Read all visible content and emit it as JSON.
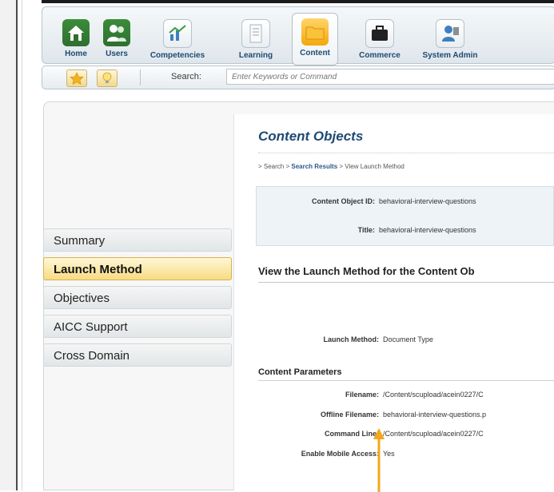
{
  "nav": {
    "items": [
      {
        "label": "Home",
        "icon": "home-icon"
      },
      {
        "label": "Users",
        "icon": "users-icon"
      },
      {
        "label": "Competencies",
        "icon": "chart-icon"
      },
      {
        "label": "Learning",
        "icon": "document-icon"
      },
      {
        "label": "Content",
        "icon": "folder-icon",
        "active": true
      },
      {
        "label": "Commerce",
        "icon": "briefcase-icon"
      },
      {
        "label": "System Admin",
        "icon": "admin-icon"
      }
    ]
  },
  "search": {
    "label": "Search:",
    "placeholder": "Enter Keywords or Command"
  },
  "sidebar": {
    "items": [
      {
        "label": "Summary"
      },
      {
        "label": "Launch Method",
        "active": true
      },
      {
        "label": "Objectives"
      },
      {
        "label": "AICC Support"
      },
      {
        "label": "Cross Domain"
      }
    ]
  },
  "content": {
    "title": "Content Objects",
    "breadcrumb": {
      "prefix": "> Search > ",
      "bold": "Search Results",
      "suffix": " > View Launch Method"
    },
    "id_label": "Content Object ID:",
    "id_value": "behavioral-interview-questions",
    "title_label": "Title:",
    "title_value": "behavioral-interview-questions",
    "section_title": "View the Launch Method for the Content Ob",
    "launch_method_label": "Launch Method:",
    "launch_method_value": "Document Type",
    "params_heading": "Content Parameters",
    "filename_label": "Filename:",
    "filename_value": "/Content/scupload/acein0227/C",
    "offline_label": "Offline Filename:",
    "offline_value": "behavioral-interview-questions.p",
    "cmd_label": "Command Line:",
    "cmd_value": "/Content/scupload/acein0227/C",
    "mobile_label": "Enable Mobile Access:",
    "mobile_value": "Yes"
  },
  "colors": {
    "nav_text": "#1e4a72",
    "title": "#1e4a72",
    "active_tab": "#f7dc84",
    "arrow": "#f3a81a"
  }
}
